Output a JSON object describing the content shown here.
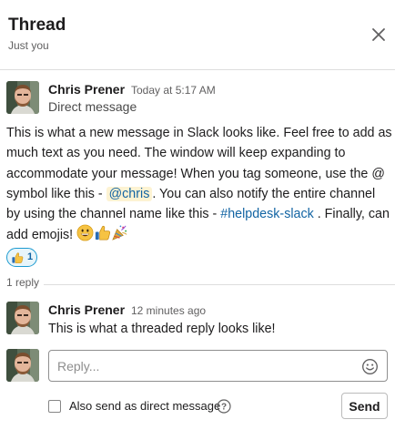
{
  "header": {
    "title": "Thread",
    "subtitle": "Just you",
    "close_icon": "close-icon"
  },
  "parent_message": {
    "author": "Chris Prener",
    "timestamp": "Today at 5:17 AM",
    "subheading": "Direct message",
    "text_1": "This is what a new message in Slack looks like. Feel free to add as much text as you need. The window will keep expanding to accommodate your message! When you tag someone, use the",
    "text_2": " @ symbol like this - ",
    "mention": "@chris",
    "text_3": ". You can also notify the entire channel by using the channel name like this - ",
    "channel": "#helpdesk-slack",
    "text_4": " . Finally, can add emojis!",
    "emojis": [
      "grinning-emoji",
      "thumbs-up-emoji",
      "party-popper-emoji"
    ],
    "reaction": {
      "icon": "thumbs-up-emoji",
      "count": "1"
    }
  },
  "thread": {
    "reply_count": "1 reply"
  },
  "reply_message": {
    "author": "Chris Prener",
    "timestamp": "12 minutes ago",
    "text": "This is what a threaded reply looks like!"
  },
  "composer": {
    "placeholder": "Reply...",
    "emoji_icon": "smiley-icon",
    "also_send_label": "Also send as direct message",
    "also_send_checked": false,
    "help_icon": "question-icon",
    "send_label": "Send"
  },
  "colors": {
    "link": "#1264a3",
    "mention_bg": "#fdf3d3",
    "reaction_border": "#1d9bd1",
    "reaction_bg": "#e8f5fa",
    "muted_text": "#616061",
    "divider": "#dddddd"
  }
}
